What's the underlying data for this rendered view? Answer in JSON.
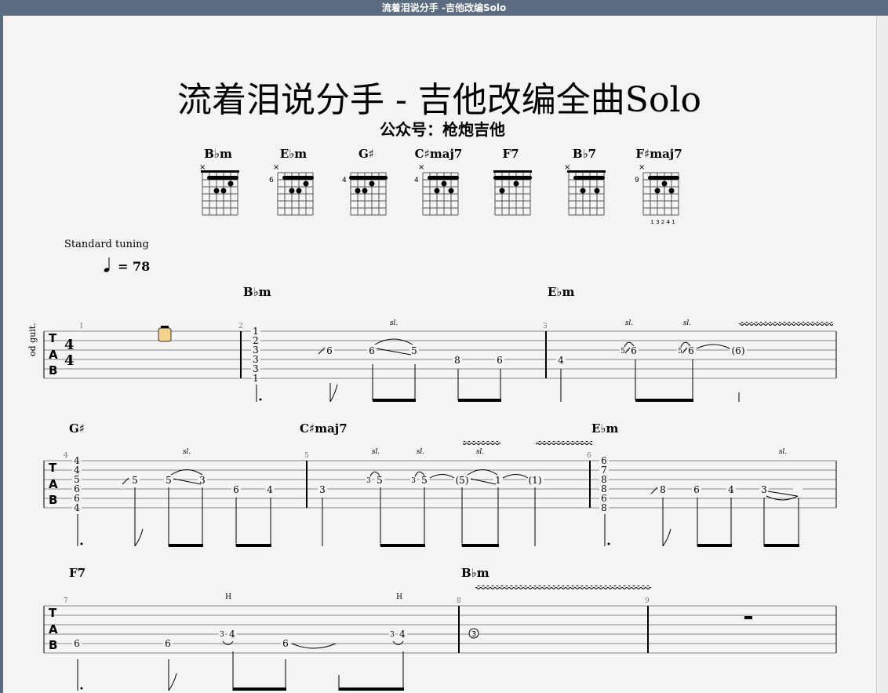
{
  "window": {
    "title": "流着泪说分手 -吉他改编Solo"
  },
  "score": {
    "title": "流着泪说分手  - 吉他改编全曲Solo",
    "subtitle": "公众号：枪炮吉他",
    "tuning": "Standard tuning",
    "tempo_value": "= 78",
    "instrument": "od guit."
  },
  "chord_diagrams": [
    {
      "name": "B♭m",
      "fret": ""
    },
    {
      "name": "E♭m",
      "fret": "6"
    },
    {
      "name": "G♯",
      "fret": "4"
    },
    {
      "name": "C♯maj7",
      "fret": "4"
    },
    {
      "name": "F7",
      "fret": ""
    },
    {
      "name": "B♭7",
      "fret": ""
    },
    {
      "name": "F♯maj7",
      "fret": "9",
      "fingering": "1 3 2 4 1"
    }
  ],
  "tab_clef": [
    "T",
    "A",
    "B"
  ],
  "time_signature": [
    "4",
    "4"
  ],
  "systems": [
    {
      "chords": [
        "B♭m",
        "E♭m"
      ],
      "measures": [
        "1",
        "2",
        "3"
      ],
      "notes": [
        "1",
        "2",
        "3",
        "3",
        "3",
        "1",
        "6",
        "6",
        "5",
        "8",
        "6",
        "4",
        "5",
        "6",
        "5",
        "6",
        "(6)"
      ],
      "techniques": [
        "sl.",
        "sl.",
        "sl."
      ]
    },
    {
      "chords": [
        "G♯",
        "C♯maj7",
        "E♭m"
      ],
      "measures": [
        "4",
        "5",
        "6"
      ],
      "notes": [
        "4",
        "4",
        "5",
        "6",
        "6",
        "4",
        "5",
        "5",
        "3",
        "6",
        "4",
        "3",
        "3",
        "5",
        "3",
        "5",
        "(5)",
        "1",
        "(1)",
        "6",
        "7",
        "8",
        "8",
        "6",
        "8",
        "8",
        "6",
        "4",
        "3"
      ],
      "techniques": [
        "sl.",
        "sl.",
        "sl.",
        "sl.",
        "sl."
      ]
    },
    {
      "chords": [
        "F7",
        "B♭m"
      ],
      "measures": [
        "7",
        "8",
        "9"
      ],
      "notes": [
        "6",
        "6",
        "3",
        "4",
        "6",
        "3",
        "4",
        "3"
      ],
      "techniques": [
        "H",
        "H"
      ]
    }
  ]
}
